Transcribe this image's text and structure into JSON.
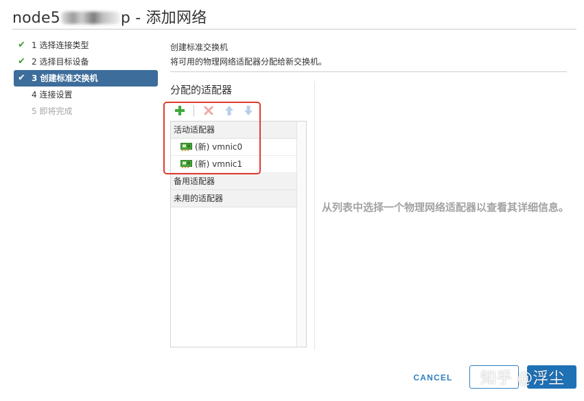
{
  "dialog": {
    "title_prefix": "node5",
    "title_suffix": "p - 添加网络"
  },
  "steps": [
    {
      "number": "1",
      "label": "选择连接类型",
      "state": "done"
    },
    {
      "number": "2",
      "label": "选择目标设备",
      "state": "done"
    },
    {
      "number": "3",
      "label": "创建标准交换机",
      "state": "active"
    },
    {
      "number": "4",
      "label": "连接设置",
      "state": "pending"
    },
    {
      "number": "5",
      "label": "即将完成",
      "state": "disabled"
    }
  ],
  "content": {
    "title": "创建标准交换机",
    "subtitle": "将可用的物理网络适配器分配给新交换机。",
    "adapters_heading": "分配的适配器"
  },
  "toolbar": {
    "add": "add-icon",
    "remove": "remove-icon",
    "move_up": "arrow-up-icon",
    "move_down": "arrow-down-icon"
  },
  "adapter_groups": {
    "active": {
      "label": "活动适配器",
      "items": [
        "(新) vmnic0",
        "(新) vmnic1"
      ]
    },
    "standby": {
      "label": "备用适配器"
    },
    "unused": {
      "label": "未用的适配器"
    }
  },
  "detail": {
    "placeholder": "从列表中选择一个物理网络适配器以查看其详细信息。"
  },
  "footer": {
    "cancel_label": "CANCEL",
    "watermark": "知乎 @浮尘"
  },
  "colors": {
    "active_step": "#3d6d9a",
    "check": "#3c9a2e",
    "primary": "#1f71b6",
    "highlight": "#e0392f"
  }
}
